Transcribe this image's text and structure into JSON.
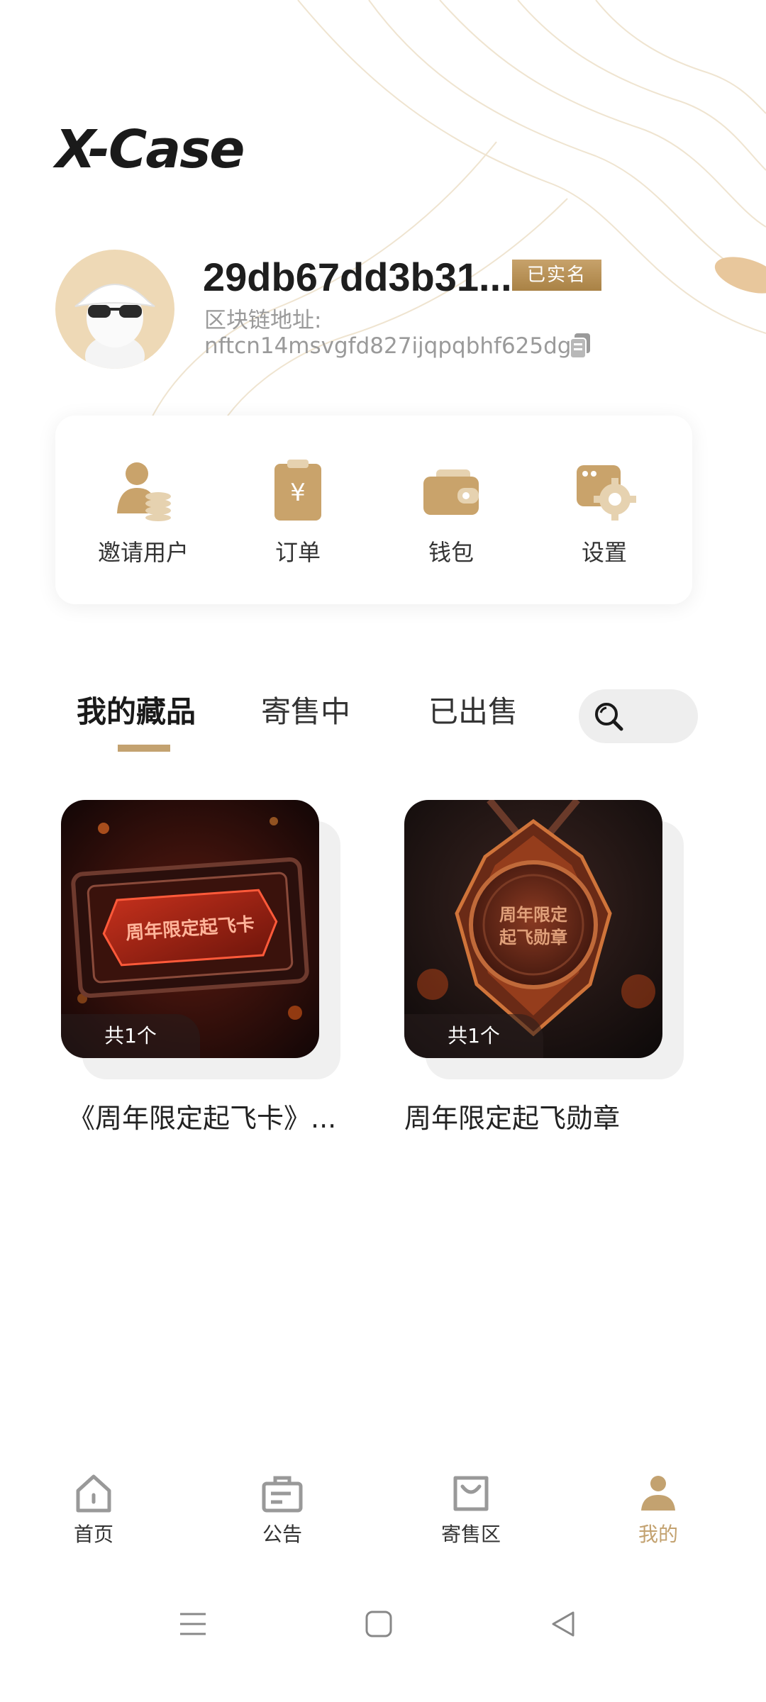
{
  "app": {
    "logo": "X-Case"
  },
  "profile": {
    "name": "29db67dd3b31...",
    "verified_badge": "已实名",
    "chain_label": "区块链地址:",
    "chain_address": "nftcn14msvgfd827ijqpqbhf625dgg"
  },
  "menu": [
    {
      "label": "邀请用户",
      "icon": "invite-user-icon"
    },
    {
      "label": "订单",
      "icon": "order-icon"
    },
    {
      "label": "钱包",
      "icon": "wallet-icon"
    },
    {
      "label": "设置",
      "icon": "settings-icon"
    }
  ],
  "tabs": [
    {
      "label": "我的藏品",
      "active": true
    },
    {
      "label": "寄售中",
      "active": false
    },
    {
      "label": "已出售",
      "active": false
    }
  ],
  "collection": [
    {
      "title": "《周年限定起飞卡》...",
      "count": "共1个",
      "art_text": "周年限定起飞卡"
    },
    {
      "title": "周年限定起飞勋章",
      "count": "共1个",
      "art_text_1": "周年限定",
      "art_text_2": "起飞勋章"
    }
  ],
  "bottom_nav": [
    {
      "label": "首页",
      "icon": "home-icon"
    },
    {
      "label": "公告",
      "icon": "announcement-icon"
    },
    {
      "label": "寄售区",
      "icon": "consignment-bag-icon"
    },
    {
      "label": "我的",
      "icon": "profile-icon",
      "active": true
    }
  ],
  "colors": {
    "accent": "#c3a270",
    "text": "#222222",
    "muted": "#9a9a9a"
  }
}
